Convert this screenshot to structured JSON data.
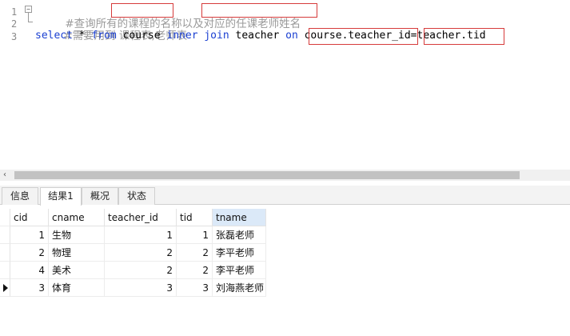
{
  "editor": {
    "line_numbers": [
      "1",
      "2",
      "3"
    ],
    "fold_symbol": "⊟",
    "line1": "#查询所有的课程的名称以及对应的任课老师姓名",
    "line2": "#需要用到 课程表,老师表",
    "line3": {
      "kw_select": "select",
      "star": " * ",
      "kw_from": "from",
      "t_course": " course ",
      "kw_inner": "inner",
      "sp1": " ",
      "kw_join": "join",
      "t_teacher": " teacher ",
      "kw_on": "on",
      "sp2": " ",
      "left_expr": "course.teacher_id",
      "eq": "=",
      "right_expr": "teacher.tid"
    }
  },
  "scrollbar": {
    "left_arrow": "‹"
  },
  "tabs": [
    {
      "label": "信息"
    },
    {
      "label": "结果1"
    },
    {
      "label": "概况"
    },
    {
      "label": "状态"
    }
  ],
  "active_tab": "结果1",
  "result": {
    "columns": [
      "cid",
      "cname",
      "teacher_id",
      "tid",
      "tname"
    ],
    "selected_column": "tname",
    "rows": [
      {
        "cid": "1",
        "cname": "生物",
        "teacher_id": "1",
        "tid": "1",
        "tname": "张磊老师"
      },
      {
        "cid": "2",
        "cname": "物理",
        "teacher_id": "2",
        "tid": "2",
        "tname": "李平老师"
      },
      {
        "cid": "4",
        "cname": "美术",
        "teacher_id": "2",
        "tid": "2",
        "tname": "李平老师"
      },
      {
        "cid": "3",
        "cname": "体育",
        "teacher_id": "3",
        "tid": "3",
        "tname": "刘海燕老师"
      }
    ],
    "current_row": 3
  },
  "colors": {
    "keyword": "#1a3fd1",
    "comment": "#9a9a9a",
    "highlight_box": "#d63b3b",
    "selected_header": "#dbe9f8"
  }
}
